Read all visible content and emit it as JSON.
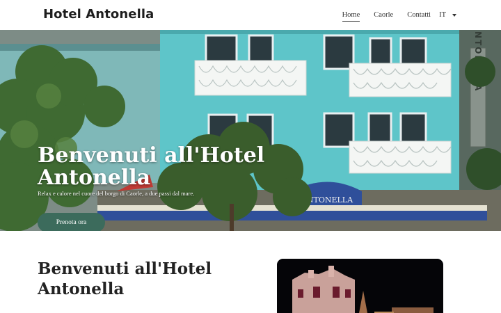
{
  "header": {
    "brand": "Hotel Antonella",
    "nav": [
      {
        "label": "Home",
        "active": true
      },
      {
        "label": "Caorle",
        "active": false
      },
      {
        "label": "Contatti",
        "active": false
      }
    ],
    "language": "IT"
  },
  "hero": {
    "title": "Benvenuti all'Hotel Antonella",
    "subtitle": "Relax e calore nel cuore del borgo di Caorle, a due passi dal mare.",
    "cta_label": "Prenota ora",
    "building_sign": "ANTONELLA",
    "awning_text": "ANTONELLA"
  },
  "content": {
    "title": "Benvenuti all'Hotel Antonella"
  },
  "colors": {
    "building": "#5ec5c9",
    "cta": "#3c6b5c",
    "awning": "#2f4f9a",
    "foliage": "#3f6a32"
  }
}
